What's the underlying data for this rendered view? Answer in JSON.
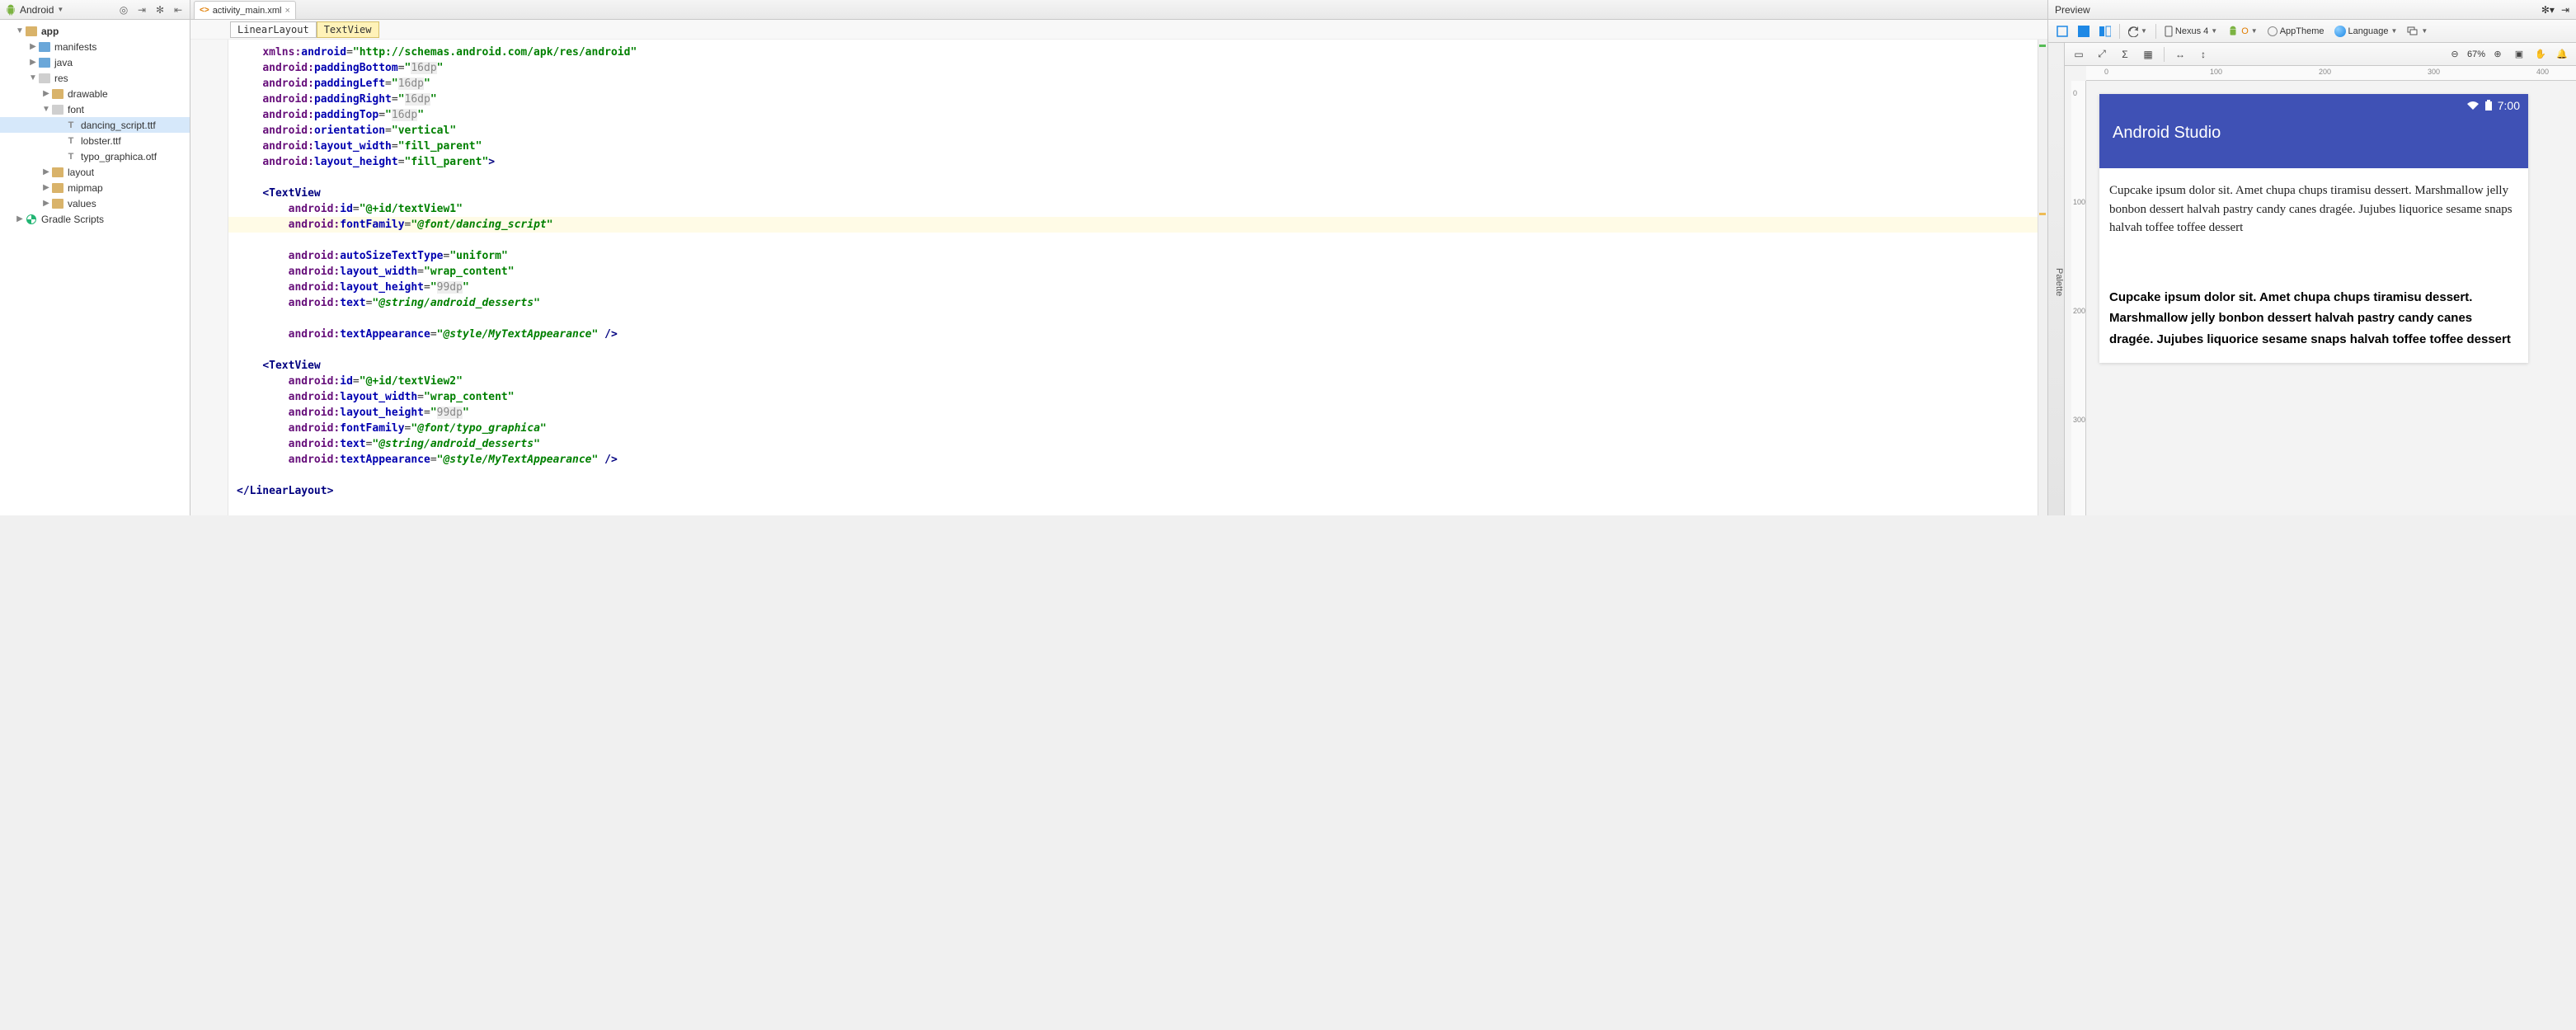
{
  "project_header": {
    "mode": "Android"
  },
  "tree": {
    "app": "app",
    "manifests": "manifests",
    "java": "java",
    "res": "res",
    "drawable": "drawable",
    "font": "font",
    "font_files": [
      "dancing_script.ttf",
      "lobster.ttf",
      "typo_graphica.otf"
    ],
    "layout": "layout",
    "mipmap": "mipmap",
    "values": "values",
    "gradle": "Gradle Scripts"
  },
  "editor": {
    "tab_name": "activity_main.xml",
    "breadcrumb": [
      "LinearLayout",
      "TextView"
    ]
  },
  "code": {
    "xmlns_val": "http://schemas.android.com/apk/res/android",
    "pad": "16dp",
    "orientation": "vertical",
    "fill": "fill_parent",
    "tv1_id": "@+id/textView1",
    "tv1_font": "@font/dancing_script",
    "autosize": "uniform",
    "wrap": "wrap_content",
    "h99": "99dp",
    "desserts": "@string/android_desserts",
    "style": "@style/MyTextAppearance",
    "tv2_id": "@+id/textView2",
    "tv2_font": "@font/typo_graphica"
  },
  "preview": {
    "title": "Preview",
    "device": "Nexus 4",
    "theme": "AppTheme",
    "language": "Language",
    "zoom": "67%",
    "status_time": "7:00",
    "app_title": "Android Studio",
    "lorem": "Cupcake ipsum dolor sit. Amet chupa chups tiramisu dessert. Marshmallow jelly bonbon dessert halvah pastry candy canes dragée. Jujubes liquorice sesame snaps halvah toffee toffee dessert",
    "ruler_h": [
      "0",
      "100",
      "200",
      "300",
      "400"
    ],
    "ruler_v": [
      "0",
      "100",
      "200",
      "300"
    ]
  }
}
